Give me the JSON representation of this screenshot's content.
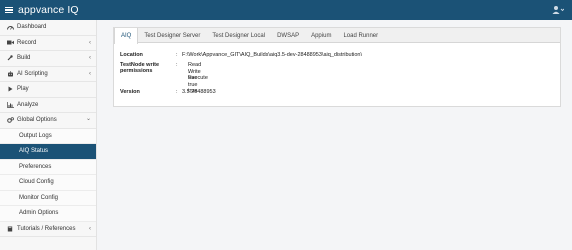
{
  "header": {
    "brand": "appvance IQ",
    "user_icon": "user-icon"
  },
  "sidebar": {
    "items": [
      {
        "label": "Dashboard",
        "icon": "dashboard-icon",
        "chevron": ""
      },
      {
        "label": "Record",
        "icon": "video-camera-icon",
        "chevron": "‹"
      },
      {
        "label": "Build",
        "icon": "wrench-icon",
        "chevron": "‹"
      },
      {
        "label": "AI Scripting",
        "icon": "robot-icon",
        "chevron": "‹"
      },
      {
        "label": "Play",
        "icon": "play-icon",
        "chevron": ""
      },
      {
        "label": "Analyze",
        "icon": "bar-chart-icon",
        "chevron": ""
      },
      {
        "label": "Global Options",
        "icon": "gears-icon",
        "chevron": "⌄"
      }
    ],
    "sub_items": [
      {
        "label": "Output Logs",
        "active": false
      },
      {
        "label": "AIQ Status",
        "active": true
      },
      {
        "label": "Preferences",
        "active": false
      },
      {
        "label": "Cloud Config",
        "active": false
      },
      {
        "label": "Monitor Config",
        "active": false
      },
      {
        "label": "Admin Options",
        "active": false
      }
    ],
    "bottom_item": {
      "label": "Tutorials / References",
      "icon": "book-icon",
      "chevron": "‹"
    }
  },
  "tabs": [
    "AIQ",
    "Test Designer Server",
    "Test Designer Local",
    "DWSAP",
    "Appium",
    "Load Runner"
  ],
  "active_tab": "AIQ",
  "status": {
    "location_label": "Location",
    "location_value": "F:\\Work\\Appvance_GIT\\AIQ_Builds\\aiq3.5-dev-28488953\\aiq_distribution\\",
    "permissions_label_1": "TestNode write",
    "permissions_label_2": "permissions",
    "read_label": "Read",
    "read_value": "true",
    "write_label": "Write",
    "write_value": "true",
    "execute_label": "Execute",
    "execute_value": "true",
    "version_label": "Version",
    "version_value": "3.5.28488953"
  },
  "colors": {
    "topbar": "#1b5276",
    "active_item": "#1b5276"
  }
}
